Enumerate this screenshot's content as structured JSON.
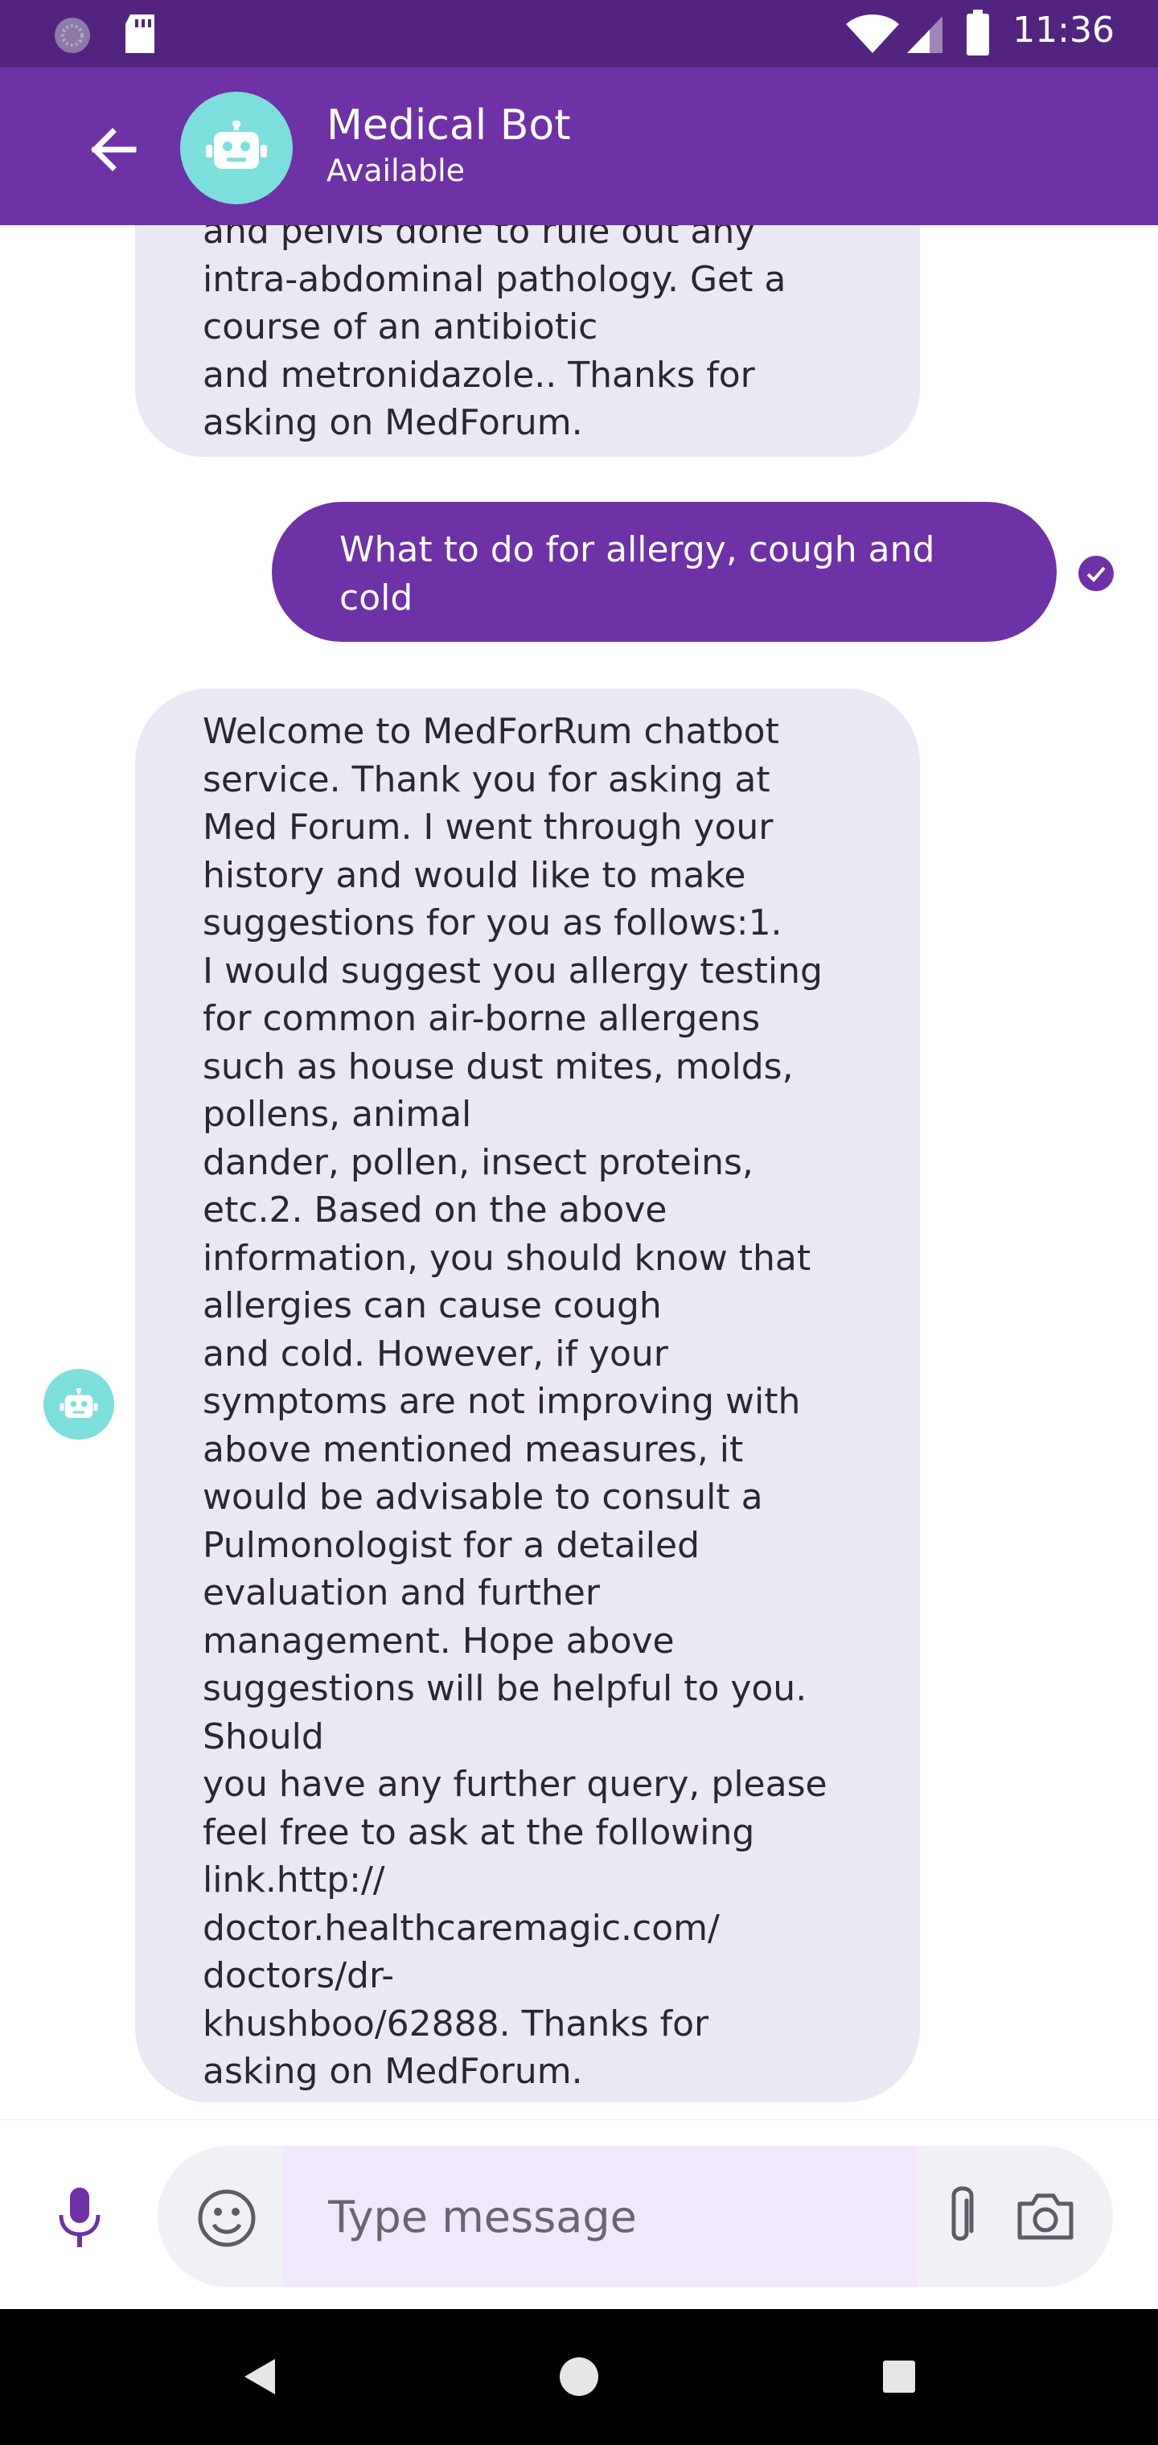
{
  "status_bar": {
    "time": "11:36"
  },
  "header": {
    "title": "Medical Bot",
    "status": "Available"
  },
  "messages": [
    {
      "sender": "bot",
      "text": "and pelvis done to rule out any\nintra-abdominal pathology. Get a\ncourse of an antibiotic\nand metronidazole.. Thanks for\nasking on MedForum."
    },
    {
      "sender": "user",
      "text": "What to do for allergy, cough and\ncold"
    },
    {
      "sender": "bot",
      "text": "Welcome to MedForRum chatbot\nservice. Thank you for asking at\nMed Forum. I went through your\nhistory and would like to make\nsuggestions for you as follows:1.\nI would suggest you allergy testing\nfor common air-borne allergens\nsuch as house dust mites, molds,\npollens, animal\ndander, pollen, insect proteins,\netc.2. Based on the above\ninformation, you should know that\nallergies can cause cough\nand cold. However, if your\nsymptoms are not improving with\nabove mentioned measures, it\nwould be advisable to consult a\nPulmonologist for a detailed\nevaluation and further\nmanagement. Hope above\nsuggestions will be helpful to you.\nShould\nyou have any further query, please\nfeel free to ask at the following\nlink.http://\ndoctor.healthcaremagic.com/\ndoctors/dr-\nkhushboo/62888. Thanks for\nasking on MedForum."
    }
  ],
  "composer": {
    "placeholder": "Type message"
  },
  "icons": {
    "back": "arrow-left-icon",
    "bot": "robot-icon",
    "read": "check-circle-icon",
    "mic": "mic-icon",
    "emoji": "emoji-icon",
    "attach": "paperclip-icon",
    "camera": "camera-icon"
  },
  "colors": {
    "status_bar": "#52247f",
    "app_bar": "#6e31a6",
    "user_bubble": "#6e31a6",
    "bot_bubble": "#ece8f3",
    "avatar": "#7ddfdc",
    "input_field": "#f1e8fd"
  }
}
